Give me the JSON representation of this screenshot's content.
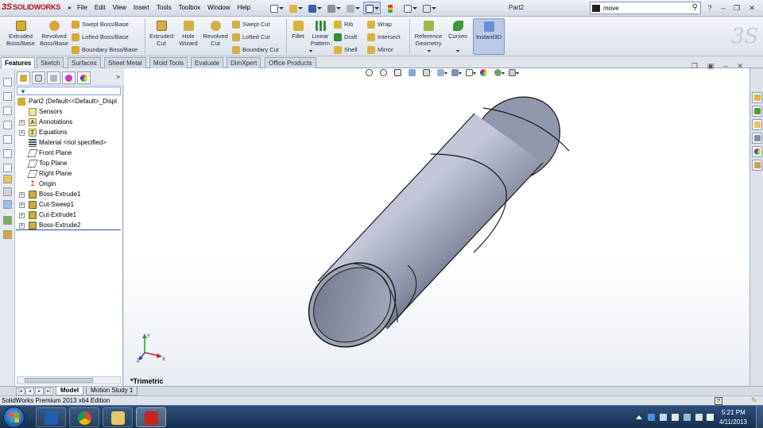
{
  "app": {
    "brand": "SOLIDWORKS",
    "document_title": "Part2",
    "status_text": "SolidWorks Premium 2013 x64 Edition"
  },
  "menu": [
    "File",
    "Edit",
    "View",
    "Insert",
    "Tools",
    "Toolbox",
    "Window",
    "Help"
  ],
  "search": {
    "value": "move"
  },
  "commands": {
    "extruded_boss": "Extruded Boss/Base",
    "revolved_boss": "Revolved Boss/Base",
    "swept_boss": "Swept Boss/Base",
    "lofted_boss": "Lofted Boss/Base",
    "boundary_boss": "Boundary Boss/Base",
    "extruded_cut": "Extruded Cut",
    "hole_wizard": "Hole Wizard",
    "revolved_cut": "Revolved Cut",
    "swept_cut": "Swept Cut",
    "lofted_cut": "Lofted Cut",
    "boundary_cut": "Boundary Cut",
    "fillet": "Fillet",
    "linear_pattern": "Linear Pattern",
    "rib": "Rib",
    "draft": "Draft",
    "shell": "Shell",
    "wrap": "Wrap",
    "intersect": "Intersect",
    "mirror": "Mirror",
    "reference_geometry": "Reference Geometry",
    "curves": "Curves",
    "instant3d": "Instant3D"
  },
  "command_tabs": [
    "Features",
    "Sketch",
    "Surfaces",
    "Sheet Metal",
    "Mold Tools",
    "Evaluate",
    "DimXpert",
    "Office Products"
  ],
  "feature_tree": {
    "root": "Part2  (Default<<Default>_Displ",
    "items": [
      {
        "label": "Sensors",
        "expandable": false
      },
      {
        "label": "Annotations",
        "expandable": true
      },
      {
        "label": "Equations",
        "expandable": true
      },
      {
        "label": "Material <not specified>",
        "expandable": false
      },
      {
        "label": "Front Plane",
        "expandable": false
      },
      {
        "label": "Top Plane",
        "expandable": false
      },
      {
        "label": "Right Plane",
        "expandable": false
      },
      {
        "label": "Origin",
        "expandable": false
      },
      {
        "label": "Boss-Extrude1",
        "expandable": true
      },
      {
        "label": "Cut-Sweep1",
        "expandable": true
      },
      {
        "label": "Cut-Extrude1",
        "expandable": true
      },
      {
        "label": "Boss-Extrude2",
        "expandable": true
      }
    ]
  },
  "bottom_tabs": [
    "Model",
    "Motion Study 1"
  ],
  "graphics": {
    "view_orientation": "*Trimetric",
    "triad": {
      "x": "X",
      "y": "Y",
      "z": "Z"
    }
  },
  "taskbar": {
    "time": "5:21 PM",
    "date": "4/11/2013",
    "apps": [
      "outlook",
      "chrome",
      "explorer",
      "solidworks"
    ]
  },
  "colors": {
    "part_body": "#8d93a6",
    "brand_red": "#b4141b",
    "taskbar": "#1f3d63"
  }
}
